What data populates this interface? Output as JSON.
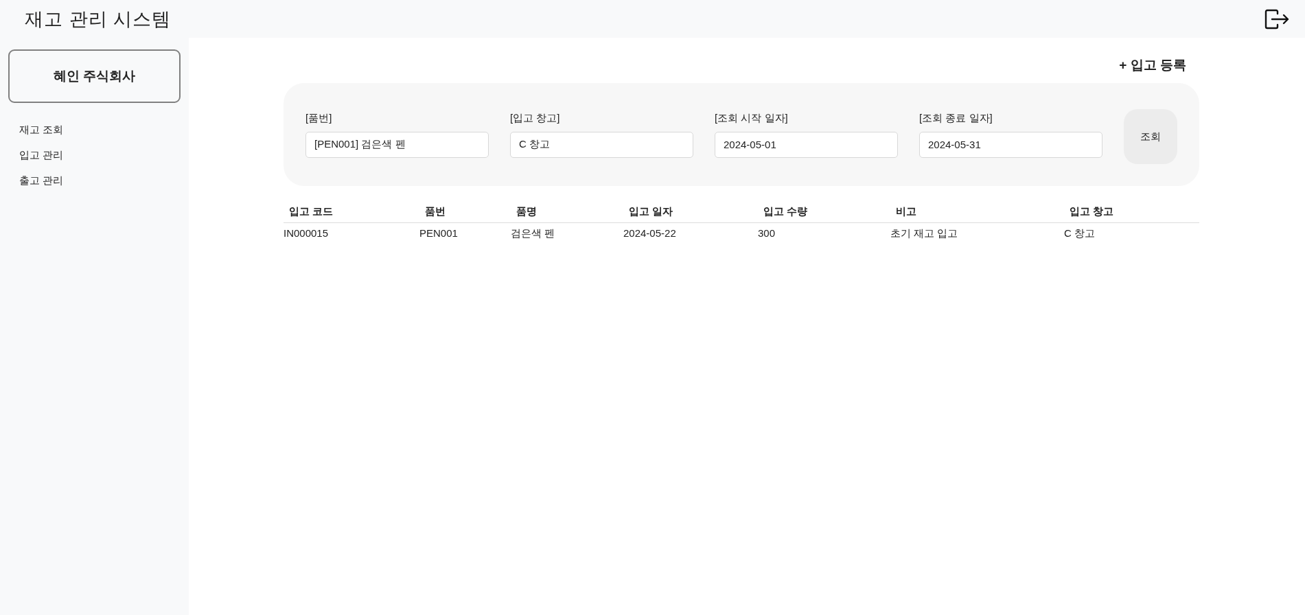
{
  "header": {
    "title": "재고 관리 시스템"
  },
  "sidebar": {
    "company": "혜인 주식회사",
    "items": [
      {
        "label": "재고 조회"
      },
      {
        "label": "입고 관리"
      },
      {
        "label": "출고 관리"
      }
    ]
  },
  "add_button": "+ 입고 등록",
  "filters": [
    {
      "label": "[품번]",
      "value": "[PEN001] 검은색 펜"
    },
    {
      "label": "[입고 창고]",
      "value": "C 창고"
    },
    {
      "label": "[조회 시작 일자]",
      "value": "2024-05-01"
    },
    {
      "label": "[조회 종료 일자]",
      "value": "2024-05-31"
    }
  ],
  "search_button": "조회",
  "table": {
    "columns": [
      "입고 코드",
      "품번",
      "품명",
      "입고 일자",
      "입고 수량",
      "비고",
      "입고 창고"
    ],
    "rows": [
      [
        "IN000015",
        "PEN001",
        "검은색 펜",
        "2024-05-22",
        "300",
        "초기 재고 입고",
        "C 창고"
      ]
    ]
  }
}
